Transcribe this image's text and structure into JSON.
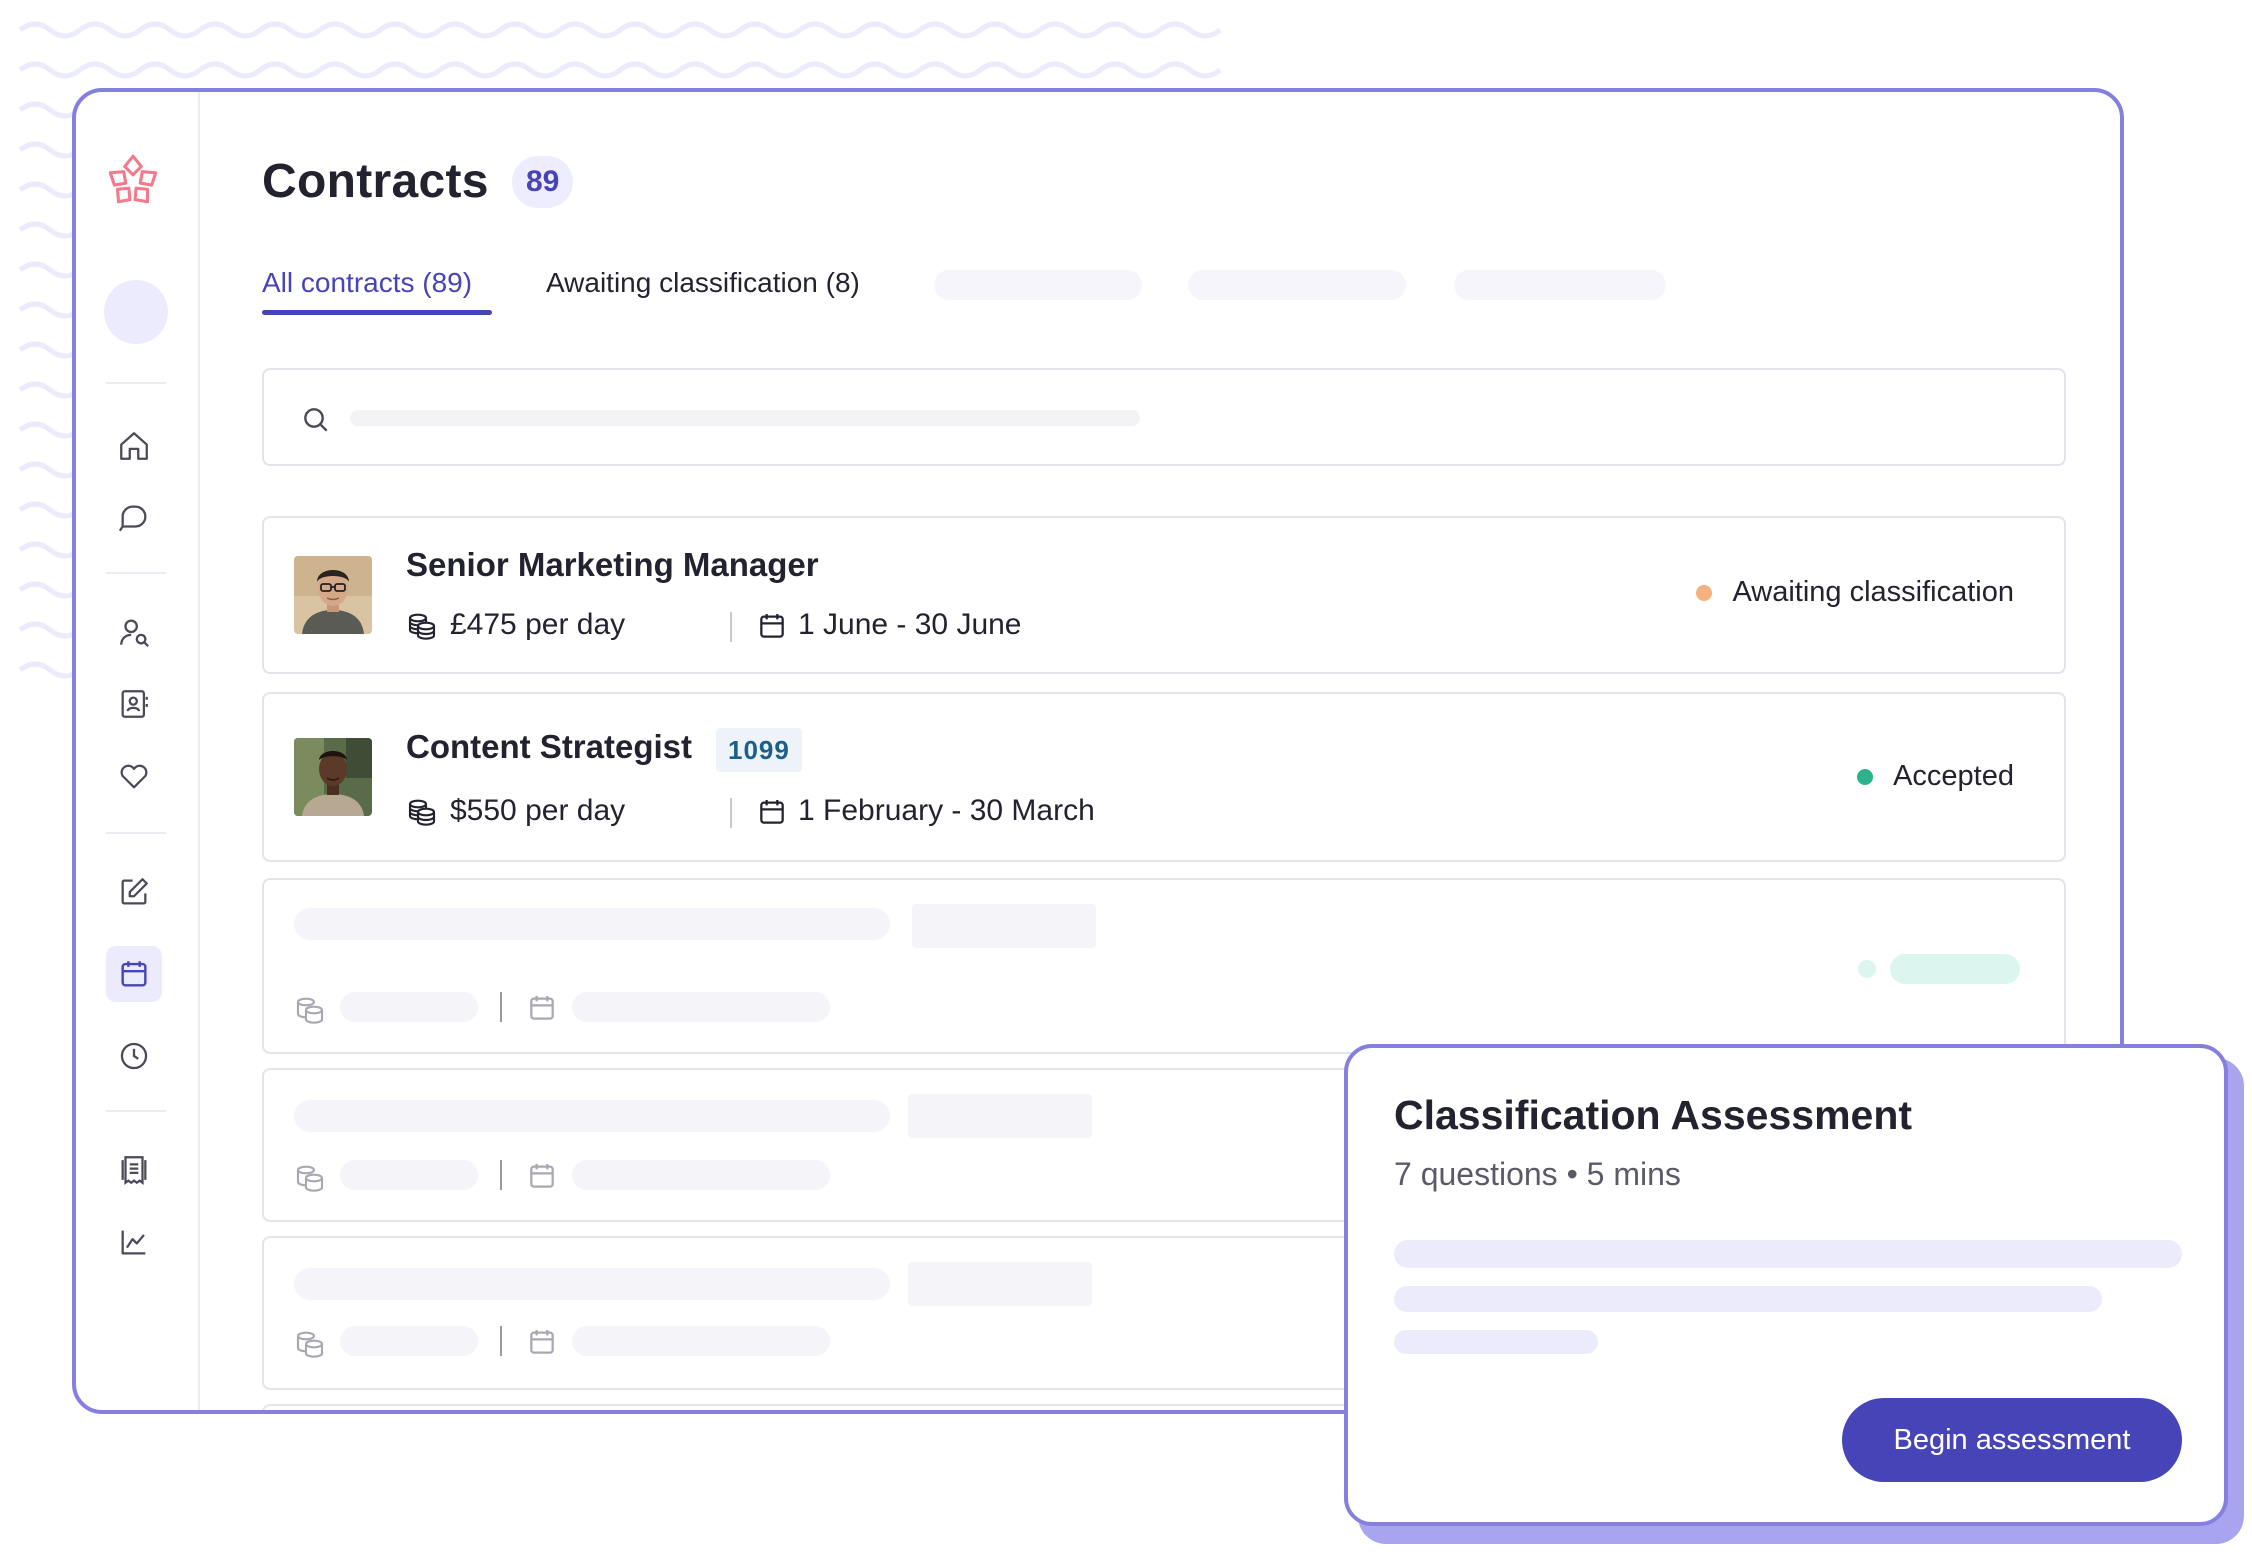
{
  "page": {
    "title": "Contracts",
    "count": "89"
  },
  "tabs": [
    {
      "label": "All contracts (89)",
      "active": true
    },
    {
      "label": "Awaiting classification (8)",
      "active": false
    }
  ],
  "sidebar": {
    "items": [
      {
        "icon": "home-icon"
      },
      {
        "icon": "chat-icon"
      },
      {
        "icon": "user-search-icon"
      },
      {
        "icon": "contact-book-icon"
      },
      {
        "icon": "heart-icon"
      },
      {
        "icon": "edit-icon"
      },
      {
        "icon": "calendar-icon",
        "active": true
      },
      {
        "icon": "clock-icon"
      },
      {
        "icon": "receipt-icon"
      },
      {
        "icon": "chart-line-icon"
      }
    ]
  },
  "contracts": [
    {
      "title": "Senior Marketing Manager",
      "rate": "£475 per day",
      "dates": "1 June - 30 June",
      "status": "Awaiting classification",
      "status_color": "#f4b07f"
    },
    {
      "title": "Content Strategist",
      "tag": "1099",
      "rate": "$550 per day",
      "dates": "1 February - 30 March",
      "status": "Accepted",
      "status_color": "#2bb38e"
    }
  ],
  "assessment": {
    "title": "Classification Assessment",
    "subtitle": "7 questions • 5 mins",
    "button": "Begin assessment"
  },
  "colors": {
    "accent": "#4744b8",
    "frame": "#8580e0"
  }
}
